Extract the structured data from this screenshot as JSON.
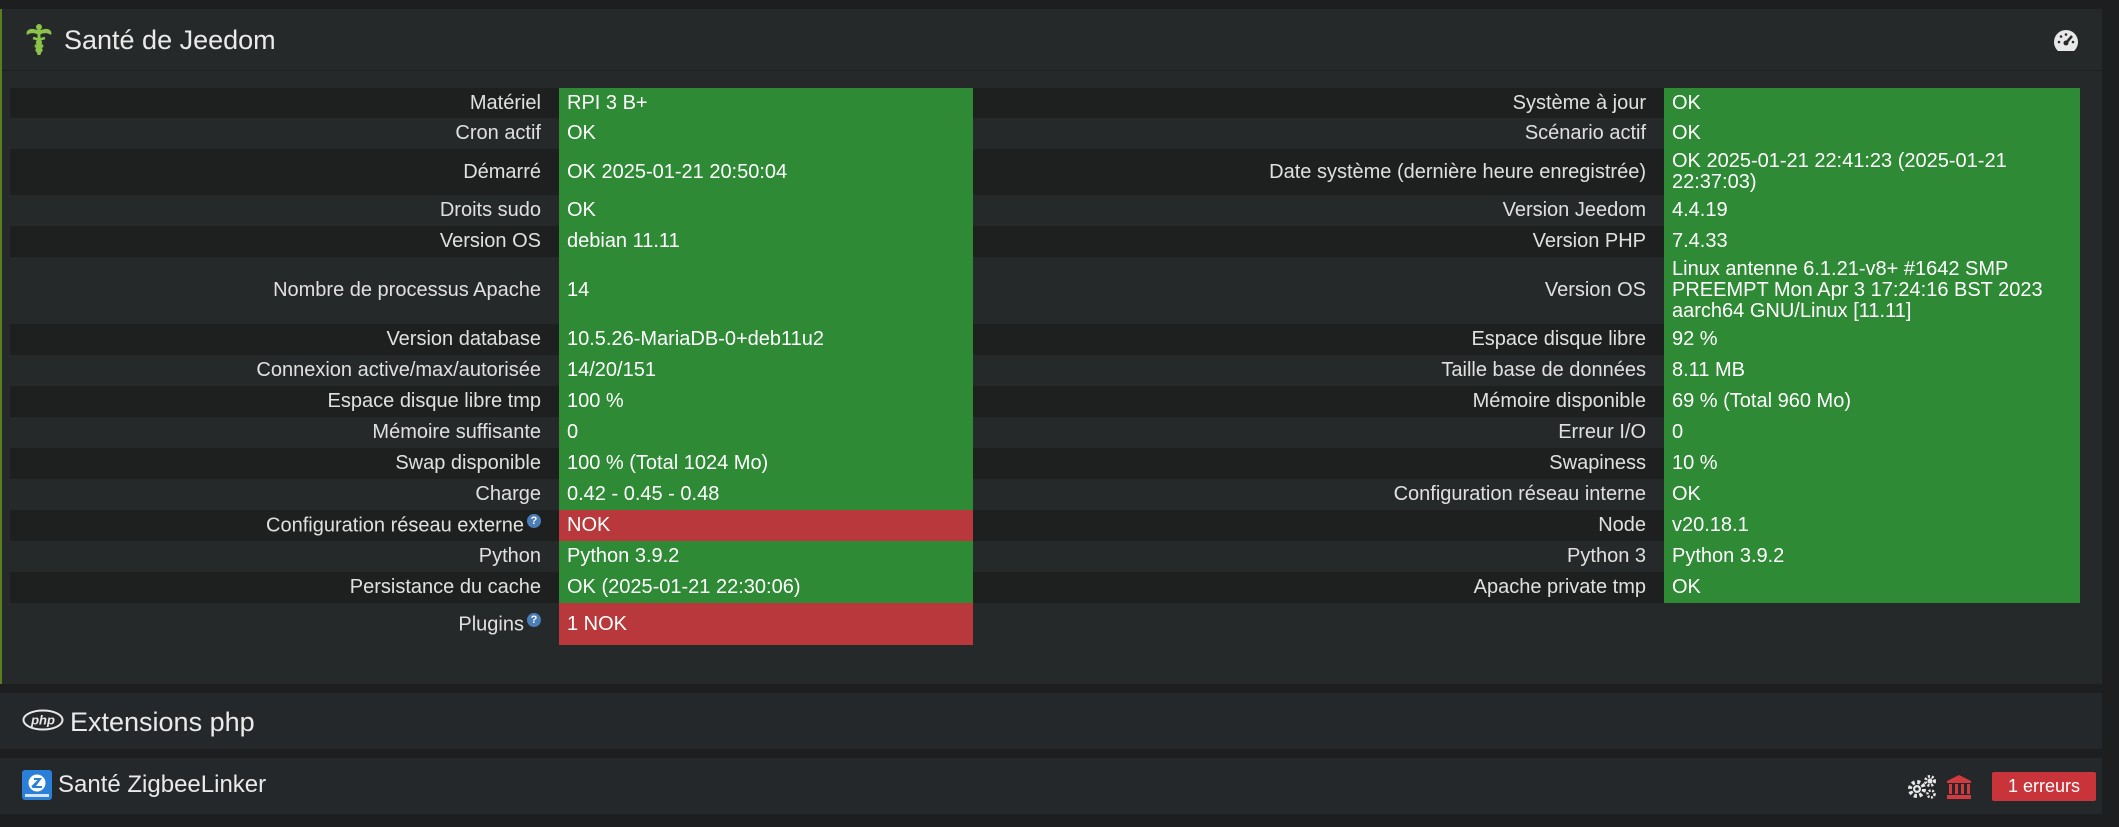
{
  "health": {
    "title": "Santé de Jeedom",
    "rows": [
      {
        "l1": "Matériel",
        "v1": "RPI 3 B+",
        "s1": "ok",
        "l2": "Système à jour",
        "v2": "OK",
        "s2": "ok",
        "h": 30
      },
      {
        "l1": "Cron actif",
        "v1": "OK",
        "s1": "ok",
        "l2": "Scénario actif",
        "v2": "OK",
        "s2": "ok",
        "h": 31
      },
      {
        "l1": "Démarré",
        "v1": "OK 2025-01-21 20:50:04",
        "s1": "ok",
        "l2": "Date système (dernière heure enregistrée)",
        "v2": "OK 2025-01-21 22:41:23 (2025-01-21 22:37:03)",
        "s2": "ok",
        "h": 46
      },
      {
        "l1": "Droits sudo",
        "v1": "OK",
        "s1": "ok",
        "l2": "Version Jeedom",
        "v2": "4.4.19",
        "s2": "ok",
        "h": 31
      },
      {
        "l1": "Version OS",
        "v1": "debian 11.11",
        "s1": "ok",
        "l2": "Version PHP",
        "v2": "7.4.33",
        "s2": "ok",
        "h": 31
      },
      {
        "l1": "Nombre de processus Apache",
        "v1": "14",
        "s1": "ok",
        "l2": "Version OS",
        "v2": "Linux antenne 6.1.21-v8+ #1642 SMP PREEMPT Mon Apr 3 17:24:16 BST 2023 aarch64 GNU/Linux [11.11]",
        "s2": "ok",
        "h": 67
      },
      {
        "l1": "Version database",
        "v1": "10.5.26-MariaDB-0+deb11u2",
        "s1": "ok",
        "l2": "Espace disque libre",
        "v2": "92 %",
        "s2": "ok",
        "h": 31
      },
      {
        "l1": "Connexion active/max/autorisée",
        "v1": "14/20/151",
        "s1": "ok",
        "l2": "Taille base de données",
        "v2": "8.11 MB",
        "s2": "ok",
        "h": 31
      },
      {
        "l1": "Espace disque libre tmp",
        "v1": "100 %",
        "s1": "ok",
        "l2": "Mémoire disponible",
        "v2": "69 % (Total 960 Mo)",
        "s2": "ok",
        "h": 31
      },
      {
        "l1": "Mémoire suffisante",
        "v1": "0",
        "s1": "ok",
        "l2": "Erreur I/O",
        "v2": "0",
        "s2": "ok",
        "h": 31
      },
      {
        "l1": "Swap disponible",
        "v1": "100 % (Total 1024 Mo)",
        "s1": "ok",
        "l2": "Swapiness",
        "v2": "10 %",
        "s2": "ok",
        "h": 31
      },
      {
        "l1": "Charge",
        "v1": "0.42 - 0.45 - 0.48",
        "s1": "ok",
        "l2": "Configuration réseau interne",
        "v2": "OK",
        "s2": "ok",
        "h": 31
      },
      {
        "l1": "Configuration réseau externe",
        "help1": "?",
        "v1": "NOK",
        "s1": "nok",
        "l2": "Node",
        "v2": "v20.18.1",
        "s2": "ok",
        "h": 31
      },
      {
        "l1": "Python",
        "v1": "Python 3.9.2",
        "s1": "ok",
        "l2": "Python 3",
        "v2": "Python 3.9.2",
        "s2": "ok",
        "h": 31
      },
      {
        "l1": "Persistance du cache",
        "v1": "OK (2025-01-21 22:30:06)",
        "s1": "ok",
        "l2": "Apache private tmp",
        "v2": "OK",
        "s2": "ok",
        "h": 31
      },
      {
        "l1": "Plugins",
        "help1": "?",
        "v1": "1 NOK",
        "s1": "nok",
        "l2": "",
        "v2": "",
        "s2": "empty",
        "h": 42
      }
    ]
  },
  "php": {
    "title": "Extensions php",
    "icon_label": "php"
  },
  "zigbee": {
    "title": "Santé ZigbeeLinker",
    "errors_label": "1 erreurs"
  },
  "colors": {
    "ok": "#2f8a36",
    "nok": "#b8383b",
    "accent": "#5a7d22"
  },
  "icons": {
    "health": "caduceus-icon",
    "dashboard": "gauge-icon",
    "php": "php-logo-icon",
    "zigbee": "zigbee-linker-icon",
    "config": "cogs-icon",
    "institution": "bank-icon"
  }
}
